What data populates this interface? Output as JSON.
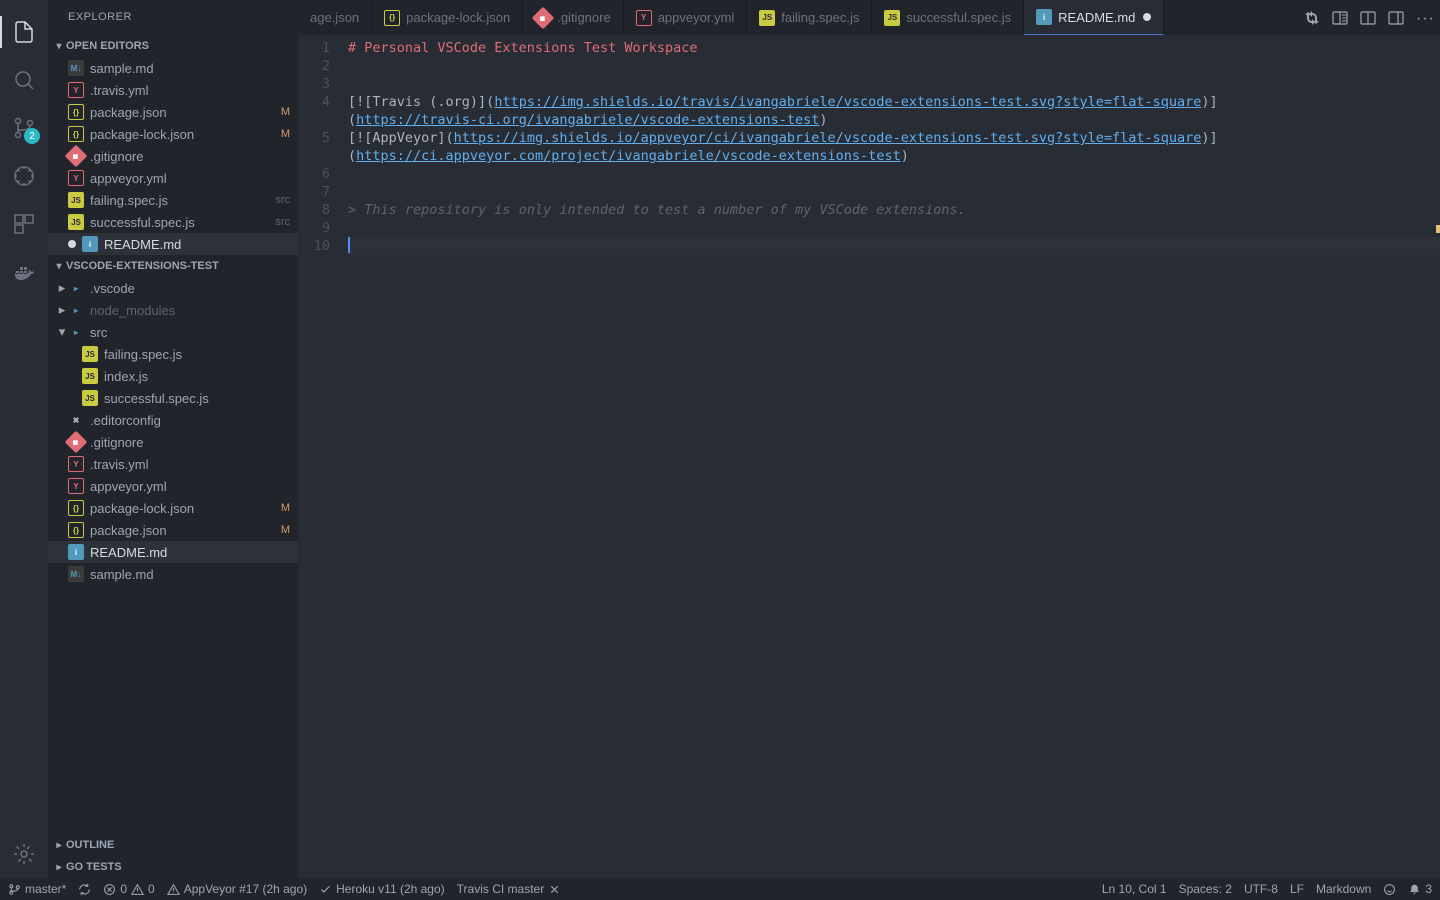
{
  "sidebar": {
    "title": "EXPLORER",
    "sections": {
      "openEditors": {
        "label": "OPEN EDITORS",
        "items": [
          {
            "name": "sample.md",
            "icon": "md"
          },
          {
            "name": ".travis.yml",
            "icon": "yml"
          },
          {
            "name": "package.json",
            "icon": "json",
            "status": "M"
          },
          {
            "name": "package-lock.json",
            "icon": "json",
            "status": "M"
          },
          {
            "name": ".gitignore",
            "icon": "git"
          },
          {
            "name": "appveyor.yml",
            "icon": "yml"
          },
          {
            "name": "failing.spec.js",
            "icon": "js",
            "hint": "src"
          },
          {
            "name": "successful.spec.js",
            "icon": "js",
            "hint": "src"
          },
          {
            "name": "README.md",
            "icon": "info",
            "dirty": true,
            "selected": true
          }
        ]
      },
      "workspace": {
        "label": "VSCODE-EXTENSIONS-TEST",
        "items": [
          {
            "name": ".vscode",
            "icon": "fold",
            "folder": true
          },
          {
            "name": "node_modules",
            "icon": "fold",
            "folder": true,
            "dim": true
          },
          {
            "name": "src",
            "icon": "fold",
            "folder": true,
            "open": true
          },
          {
            "name": "failing.spec.js",
            "icon": "js",
            "depth": 1
          },
          {
            "name": "index.js",
            "icon": "js",
            "depth": 1
          },
          {
            "name": "successful.spec.js",
            "icon": "js",
            "depth": 1
          },
          {
            "name": ".editorconfig",
            "icon": "tool"
          },
          {
            "name": ".gitignore",
            "icon": "git"
          },
          {
            "name": ".travis.yml",
            "icon": "yml"
          },
          {
            "name": "appveyor.yml",
            "icon": "yml"
          },
          {
            "name": "package-lock.json",
            "icon": "json",
            "status": "M"
          },
          {
            "name": "package.json",
            "icon": "json",
            "status": "M"
          },
          {
            "name": "README.md",
            "icon": "info",
            "selected": true
          },
          {
            "name": "sample.md",
            "icon": "md"
          }
        ]
      },
      "outline": {
        "label": "OUTLINE"
      },
      "goTests": {
        "label": "GO TESTS"
      }
    }
  },
  "activityBadge": "2",
  "tabs": [
    {
      "name": "age.json",
      "icon": "none"
    },
    {
      "name": "package-lock.json",
      "icon": "json"
    },
    {
      "name": ".gitignore",
      "icon": "git"
    },
    {
      "name": "appveyor.yml",
      "icon": "yml"
    },
    {
      "name": "failing.spec.js",
      "icon": "js"
    },
    {
      "name": "successful.spec.js",
      "icon": "js"
    },
    {
      "name": "README.md",
      "icon": "info",
      "active": true,
      "dirty": true
    }
  ],
  "editor": {
    "lines": [
      {
        "n": 1,
        "kind": "h",
        "text": "# Personal VSCode Extensions Test Workspace"
      },
      {
        "n": 2,
        "kind": "blank"
      },
      {
        "n": 3,
        "kind": "blank"
      },
      {
        "n": 4,
        "kind": "link1a",
        "pre": "[![Travis (.org)](",
        "url": "https://img.shields.io/travis/ivangabriele/vscode-extensions-test.svg?style=flat-square",
        "post": ")]"
      },
      {
        "kind": "link1b",
        "pre": "(",
        "url": "https://travis-ci.org/ivangabriele/vscode-extensions-test",
        "post": ")"
      },
      {
        "n": 5,
        "kind": "link2a",
        "pre": "[![AppVeyor](",
        "url": "https://img.shields.io/appveyor/ci/ivangabriele/vscode-extensions-test.svg?style=flat-square",
        "post": ")]"
      },
      {
        "kind": "link2b",
        "pre": "(",
        "url": "https://ci.appveyor.com/project/ivangabriele/vscode-extensions-test",
        "post": ")"
      },
      {
        "n": 6,
        "kind": "blank"
      },
      {
        "n": 7,
        "kind": "blank"
      },
      {
        "n": 8,
        "kind": "quote",
        "prefix": "> ",
        "text": "This repository is only intended to test a number of my VSCode extensions."
      },
      {
        "n": 9,
        "kind": "blank"
      },
      {
        "n": 10,
        "kind": "cursor"
      }
    ]
  },
  "statusBar": {
    "branch": "master*",
    "errors": "0",
    "warnings": "0",
    "appveyor": "AppVeyor #17 (2h ago)",
    "heroku": "Heroku v11 (2h ago)",
    "travis": "Travis CI master",
    "position": "Ln 10, Col 1",
    "spaces": "Spaces: 2",
    "encoding": "UTF-8",
    "eol": "LF",
    "language": "Markdown",
    "notifications": "3"
  }
}
